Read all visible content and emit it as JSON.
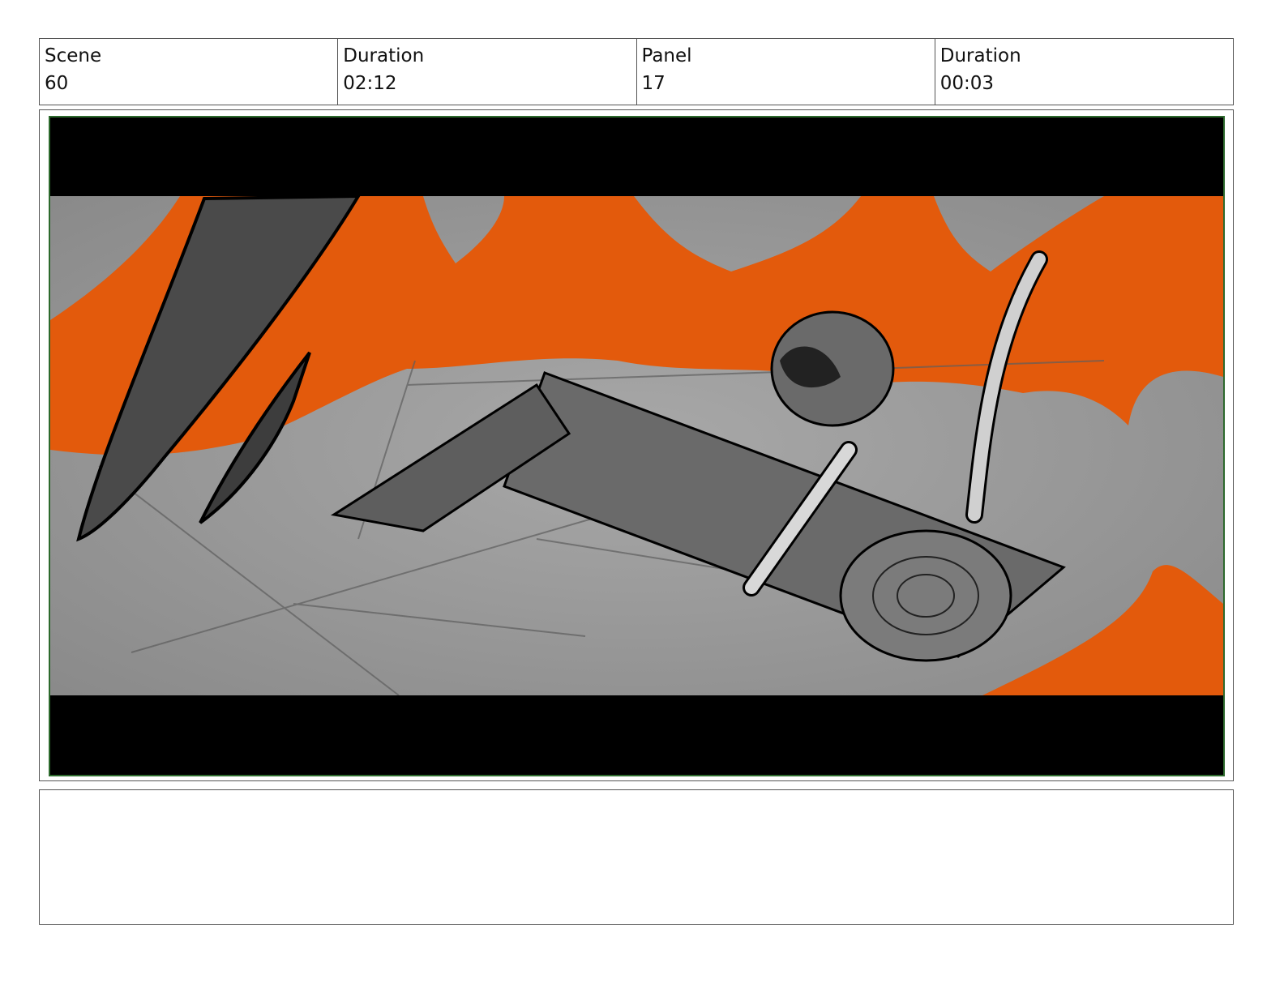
{
  "header": {
    "scene_label": "Scene",
    "scene_value": "60",
    "scene_duration_label": "Duration",
    "scene_duration_value": "02:12",
    "panel_label": "Panel",
    "panel_value": "17",
    "panel_duration_label": "Duration",
    "panel_duration_value": "00:03"
  },
  "panel": {
    "image_description_icon": "storyboard-frame-image"
  },
  "colors": {
    "lava": "#e35a0c",
    "floor": "#9c9c9c",
    "letterbox": "#000000",
    "frame_border": "#2d6a2d"
  },
  "notes": {
    "text": ""
  }
}
